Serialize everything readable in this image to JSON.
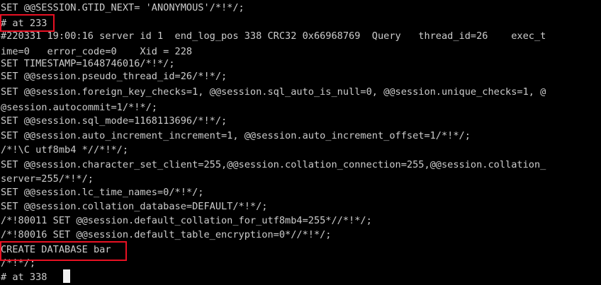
{
  "terminal": {
    "lines": [
      "SET @@SESSION.GTID_NEXT= 'ANONYMOUS'/*!*/;",
      "# at 233",
      "#220331 19:00:16 server id 1  end_log_pos 338 CRC32 0x66968769  Query   thread_id=26    exec_t",
      "ime=0   error_code=0    Xid = 228",
      "SET TIMESTAMP=1648746016/*!*/;",
      "SET @@session.pseudo_thread_id=26/*!*/;",
      "SET @@session.foreign_key_checks=1, @@session.sql_auto_is_null=0, @@session.unique_checks=1, @",
      "@session.autocommit=1/*!*/;",
      "SET @@session.sql_mode=1168113696/*!*/;",
      "SET @@session.auto_increment_increment=1, @@session.auto_increment_offset=1/*!*/;",
      "/*!\\C utf8mb4 *//*!*/;",
      "SET @@session.character_set_client=255,@@session.collation_connection=255,@@session.collation_",
      "server=255/*!*/;",
      "SET @@session.lc_time_names=0/*!*/;",
      "SET @@session.collation_database=DEFAULT/*!*/;",
      "/*!80011 SET @@session.default_collation_for_utf8mb4=255*//*!*/;",
      "/*!80016 SET @@session.default_table_encryption=0*//*!*/;",
      "CREATE DATABASE bar",
      "/*!*/;",
      "# at 338"
    ],
    "highlight_color": "#e81123",
    "text_color": "#cccccc",
    "background_color": "#000000"
  }
}
